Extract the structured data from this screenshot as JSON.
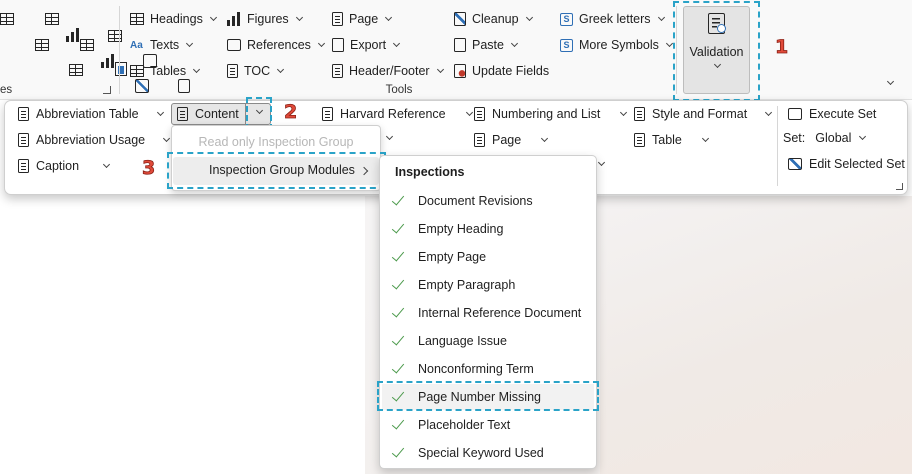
{
  "ribbon": {
    "left_groups": [
      {
        "label": "es"
      }
    ],
    "tools_group_label": "Tools",
    "col1": [
      {
        "label": "Headings",
        "icon": "headings-icon"
      },
      {
        "label": "Texts",
        "icon": "texts-icon",
        "icon_text": "Aa"
      },
      {
        "label": "Tables",
        "icon": "tables-icon"
      }
    ],
    "col2": [
      {
        "label": "Figures",
        "icon": "figures-icon"
      },
      {
        "label": "References",
        "icon": "references-icon"
      },
      {
        "label": "TOC",
        "icon": "toc-icon"
      }
    ],
    "col3": [
      {
        "label": "Page",
        "icon": "page-icon"
      },
      {
        "label": "Export",
        "icon": "export-icon"
      },
      {
        "label": "Header/Footer",
        "icon": "header-footer-icon"
      }
    ],
    "col4": [
      {
        "label": "Cleanup",
        "icon": "cleanup-icon"
      },
      {
        "label": "Paste",
        "icon": "paste-icon"
      },
      {
        "label": "Update Fields",
        "icon": "update-fields-icon"
      }
    ],
    "col5": [
      {
        "label": "Greek letters",
        "icon": "greek-letters-icon",
        "icon_text": "S"
      },
      {
        "label": "More Symbols",
        "icon": "more-symbols-icon",
        "icon_text": "S"
      }
    ],
    "validation": {
      "label": "Validation"
    }
  },
  "flyout": {
    "col1": [
      {
        "label": "Abbreviation Table"
      },
      {
        "label": "Abbreviation Usage"
      },
      {
        "label": "Caption"
      }
    ],
    "content_label": "Content",
    "col3": [
      {
        "label": "Harvard Reference"
      }
    ],
    "col4": [
      {
        "label": "Numbering and List"
      },
      {
        "label": "Page"
      }
    ],
    "col5": [
      {
        "label": "Style and Format"
      },
      {
        "label": "Table"
      }
    ],
    "sets": {
      "execute_label": "Execute Set",
      "set_prefix": "Set:",
      "set_value": "Global",
      "edit_label": "Edit Selected Set"
    }
  },
  "content_menu": {
    "items": [
      {
        "label": "Read only Inspection Group",
        "disabled": true
      },
      {
        "label": "Inspection Group Modules",
        "has_submenu": true
      }
    ]
  },
  "inspections_menu": {
    "header": "Inspections",
    "items": [
      {
        "label": "Document Revisions",
        "checked": true
      },
      {
        "label": "Empty Heading",
        "checked": true
      },
      {
        "label": "Empty Page",
        "checked": true
      },
      {
        "label": "Empty Paragraph",
        "checked": true
      },
      {
        "label": "Internal Reference Document",
        "checked": true
      },
      {
        "label": "Language Issue",
        "checked": true
      },
      {
        "label": "Nonconforming Term",
        "checked": true
      },
      {
        "label": "Page Number Missing",
        "checked": true
      },
      {
        "label": "Placeholder Text",
        "checked": true
      },
      {
        "label": "Special Keyword Used",
        "checked": true
      }
    ]
  },
  "annotations": {
    "step1": "1",
    "step2": "2",
    "step3": "3",
    "marker_color": "#e04a3a",
    "highlight_color": "#2aa3c8"
  }
}
